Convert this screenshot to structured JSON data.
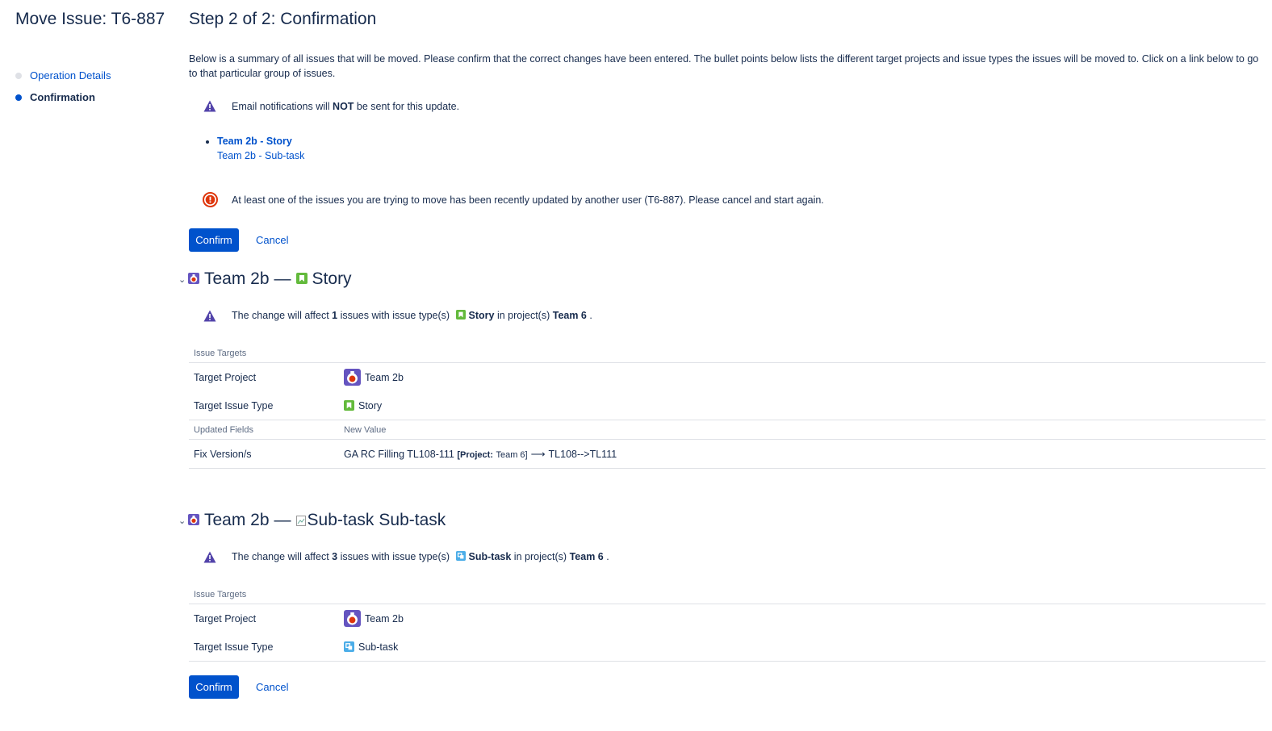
{
  "page": {
    "title": "Move Issue: T6-887"
  },
  "nav": {
    "items": [
      {
        "label": "Operation Details",
        "state": "done"
      },
      {
        "label": "Confirmation",
        "state": "current"
      }
    ]
  },
  "main": {
    "step_title": "Step 2 of 2: Confirmation",
    "intro": "Below is a summary of all issues that will be moved. Please confirm that the correct changes have been entered. The bullet points below lists the different target projects and issue types the issues will be moved to. Click on a link below to go to that particular group of issues.",
    "email_notice": {
      "pre": "Email notifications will ",
      "strong": "NOT",
      "post": " be sent for this update."
    },
    "targets": [
      "Team 2b - Story",
      "Team 2b - Sub-task"
    ],
    "error": "At least one of the issues you are trying to move has been recently updated by another user (T6-887). Please cancel and start again.",
    "confirm_label": "Confirm",
    "cancel_label": "Cancel"
  },
  "groups": [
    {
      "project": "Team 2b",
      "dash": "—",
      "issue_type": "Story",
      "alt_text": "",
      "change": {
        "pre": "The change will affect ",
        "count": "1",
        "mid": " issues with issue type(s) ",
        "type": "Story",
        "mid2": " in project(s) ",
        "project": "Team 6",
        "post": " ."
      },
      "targets_header": "Issue Targets",
      "target_project_label": "Target Project",
      "target_project_value": "Team 2b",
      "target_type_label": "Target Issue Type",
      "target_type_value": "Story",
      "updated_header": "Updated Fields",
      "new_value_header": "New Value",
      "field_label": "Fix Version/s",
      "field_old": "GA RC Filling TL108-111",
      "field_project_label": "[Project:",
      "field_project_value": "Team 6]",
      "field_arrow": "⟶",
      "field_new": "TL108-->TL111"
    },
    {
      "project": "Team 2b",
      "dash": "—",
      "issue_type": "Sub-task",
      "alt_text": "Sub-task",
      "change": {
        "pre": "The change will affect ",
        "count": "3",
        "mid": " issues with issue type(s) ",
        "type": "Sub-task",
        "mid2": " in project(s) ",
        "project": "Team 6",
        "post": " ."
      },
      "targets_header": "Issue Targets",
      "target_project_label": "Target Project",
      "target_project_value": "Team 2b",
      "target_type_label": "Target Issue Type",
      "target_type_value": "Sub-task"
    }
  ],
  "colors": {
    "accent": "#0052cc",
    "warning": "#5243aa",
    "error": "#de350b",
    "story": "#63ba3c",
    "subtask": "#4bade8"
  }
}
